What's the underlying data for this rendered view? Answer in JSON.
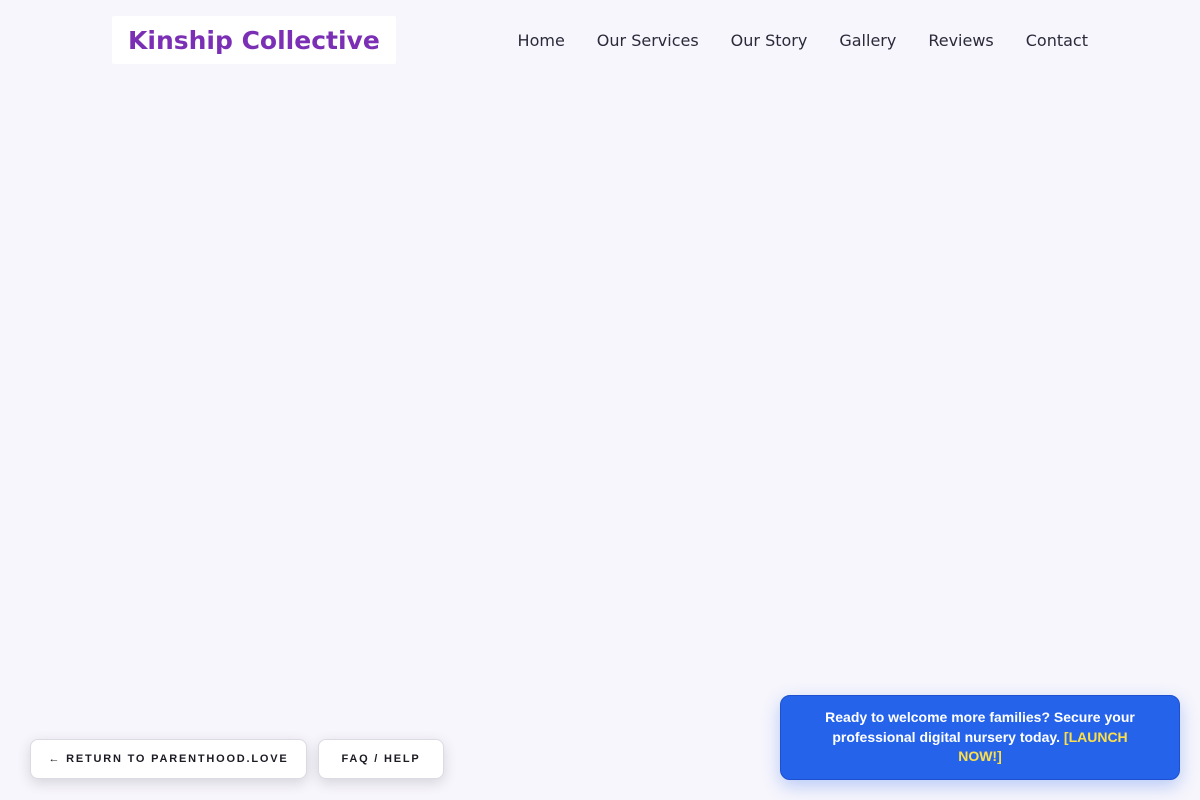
{
  "header": {
    "brand": "Kinship Collective",
    "nav": [
      {
        "label": "Home"
      },
      {
        "label": "Our Services"
      },
      {
        "label": "Our Story"
      },
      {
        "label": "Gallery"
      },
      {
        "label": "Reviews"
      },
      {
        "label": "Contact"
      }
    ]
  },
  "footer_buttons": {
    "return_label": "← RETURN TO PARENTHOOD.LOVE",
    "faq_label": "FAQ / HELP"
  },
  "promo": {
    "text": "Ready to welcome more families? Secure your professional digital nursery today.",
    "cta": "[LAUNCH NOW!]"
  },
  "colors": {
    "background": "#f7f6fc",
    "brand": "#7b2fb5",
    "promo_bg": "#2563eb",
    "promo_cta": "#fde047"
  }
}
